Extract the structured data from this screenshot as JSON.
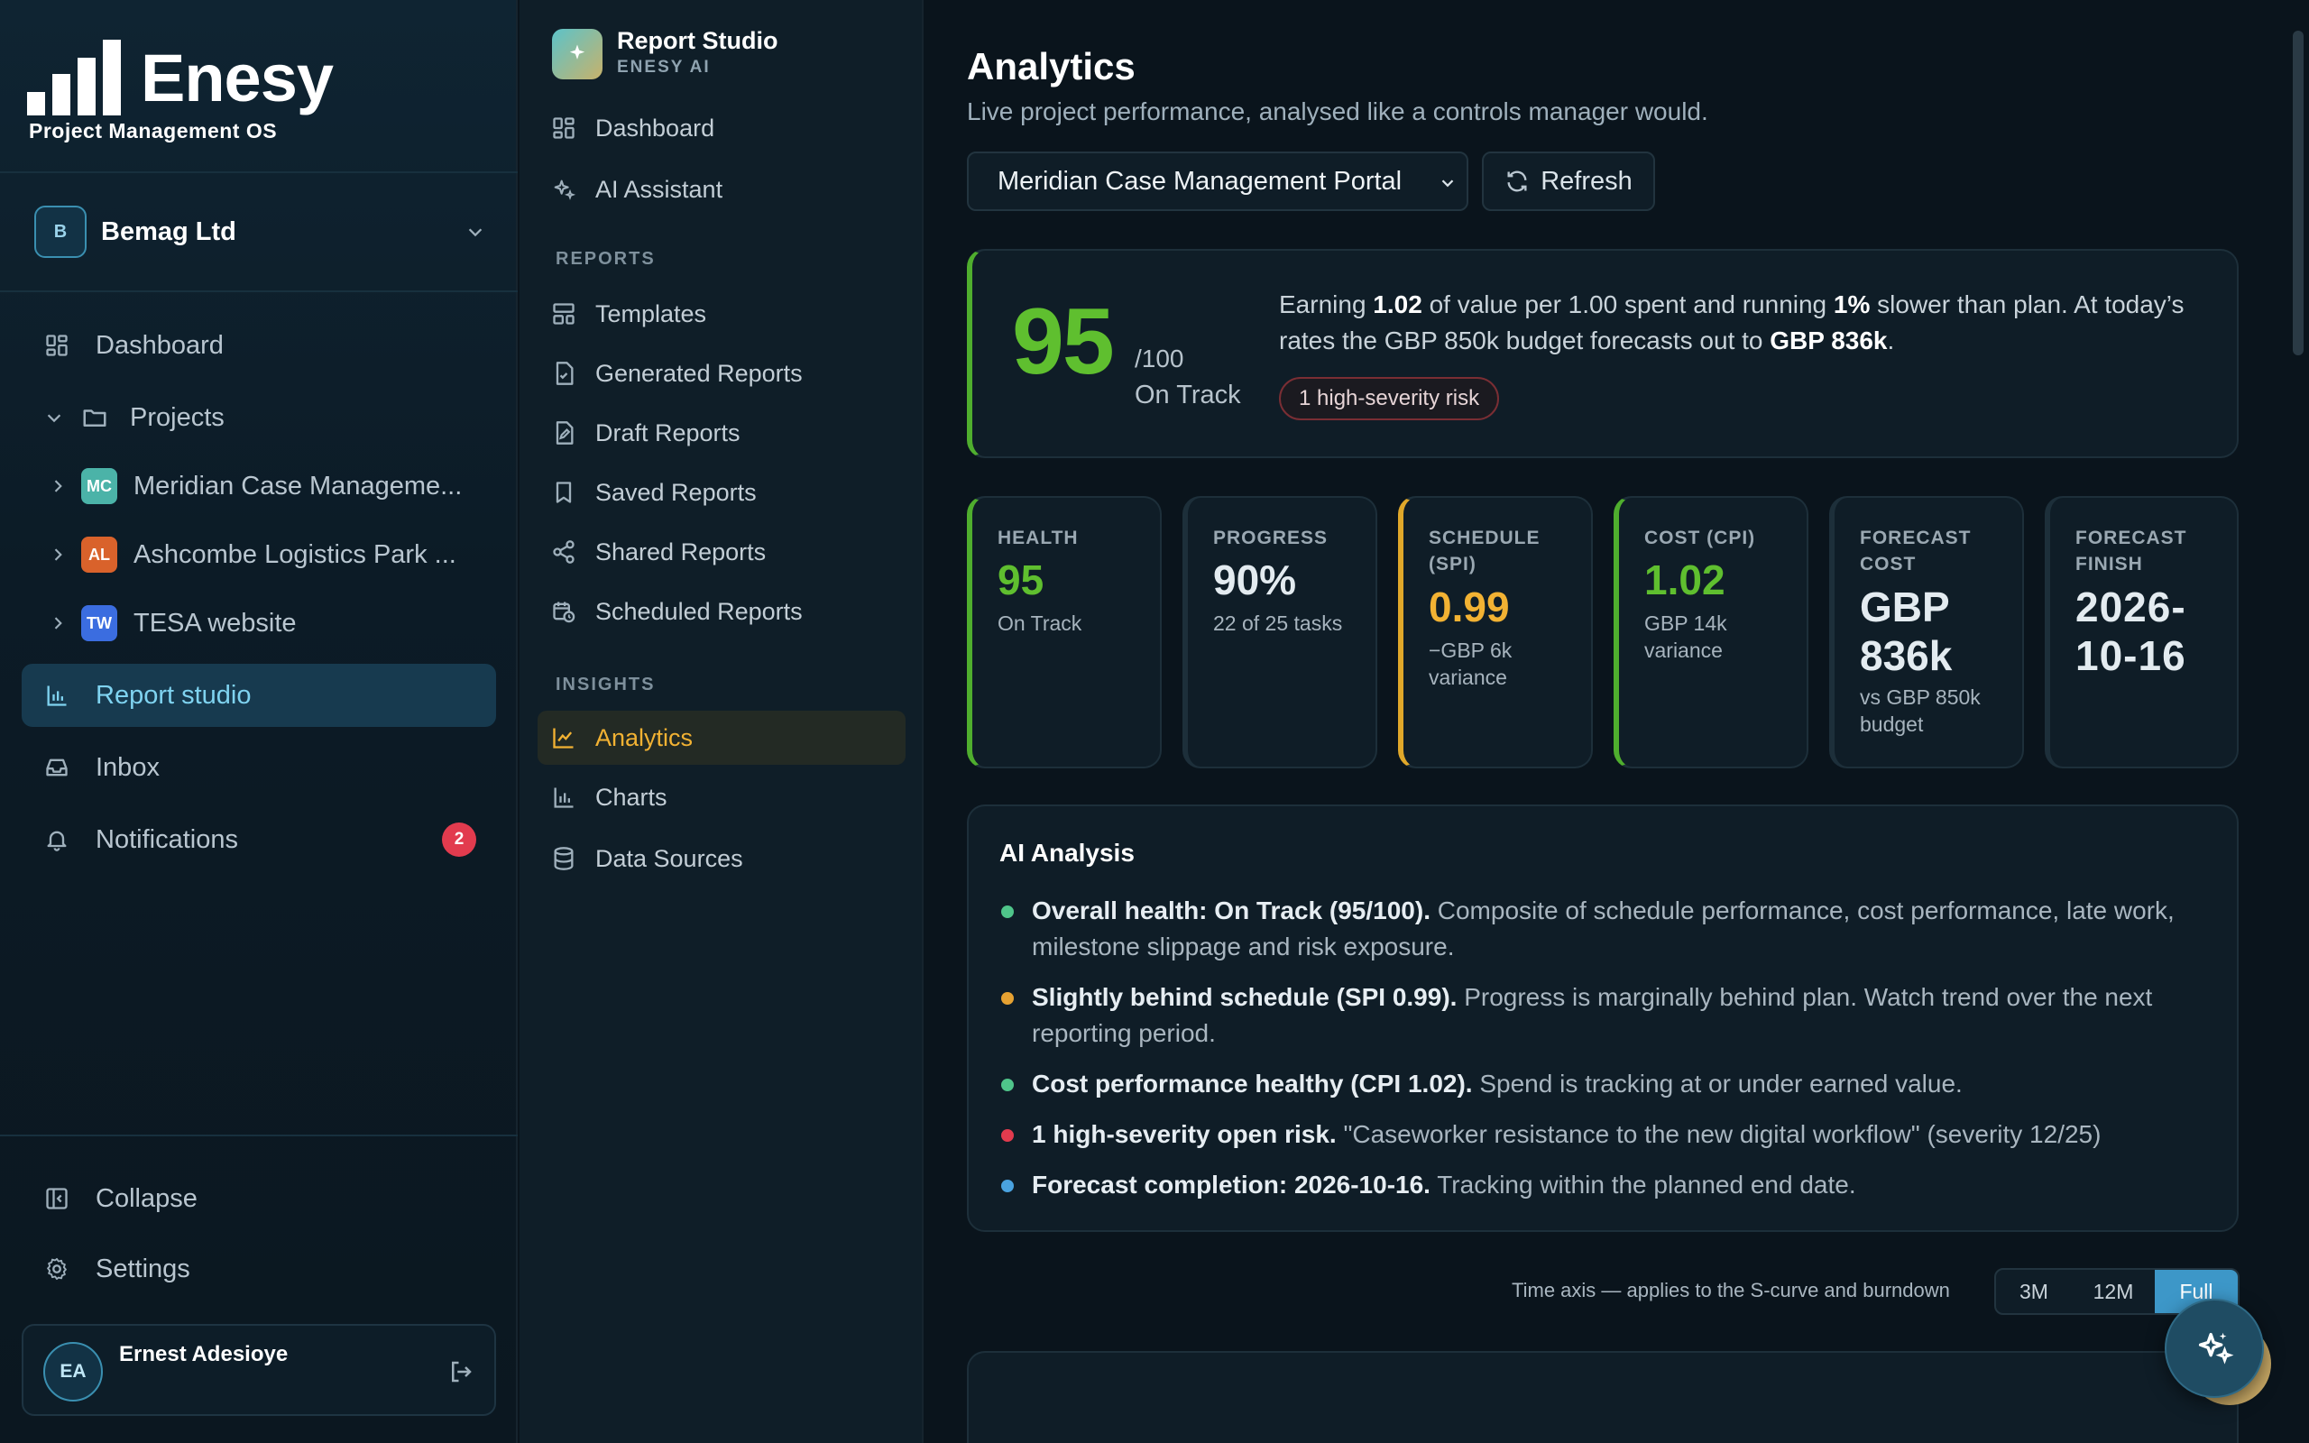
{
  "brand": {
    "name": "Enesy",
    "tagline": "Project Management OS"
  },
  "org": {
    "initial": "B",
    "name": "Bemag Ltd"
  },
  "nav": {
    "dashboard": "Dashboard",
    "projects": "Projects",
    "project_items": [
      {
        "initials": "MC",
        "name": "Meridian Case Manageme...",
        "color": "#4bb3a8"
      },
      {
        "initials": "AL",
        "name": "Ashcombe Logistics Park ...",
        "color": "#d9622b"
      },
      {
        "initials": "TW",
        "name": "TESA website",
        "color": "#3b6de0"
      }
    ],
    "report_studio": "Report studio",
    "inbox": "Inbox",
    "notifications": "Notifications",
    "notifications_count": "2",
    "collapse": "Collapse",
    "settings": "Settings"
  },
  "user": {
    "initials": "EA",
    "name": "Ernest Adesioye"
  },
  "panel": {
    "title": "Report Studio",
    "subtitle": "ENESY AI",
    "dashboard": "Dashboard",
    "ai_assistant": "AI Assistant",
    "reports_heading": "REPORTS",
    "templates": "Templates",
    "generated": "Generated Reports",
    "draft": "Draft Reports",
    "saved": "Saved Reports",
    "shared": "Shared Reports",
    "scheduled": "Scheduled Reports",
    "insights_heading": "INSIGHTS",
    "analytics": "Analytics",
    "charts": "Charts",
    "data_sources": "Data Sources"
  },
  "main": {
    "title": "Analytics",
    "subtitle": "Live project performance, analysed like a controls manager would.",
    "project_select": "Meridian Case Management Portal",
    "refresh": "Refresh"
  },
  "score": {
    "value": "95",
    "max": "/100",
    "status": "On Track",
    "text_1": "Earning ",
    "text_b1": "1.02",
    "text_2": " of value per 1.00 spent and running ",
    "text_b2": "1%",
    "text_3": " slower than plan. At today’s rates the GBP 850k budget forecasts out to ",
    "text_b3": "GBP 836k",
    "text_4": ".",
    "risk_pill": "1 high-severity risk"
  },
  "metrics": [
    {
      "label": "HEALTH",
      "value": "95",
      "sub": "On Track",
      "value_color": "#5fbf2f"
    },
    {
      "label": "PROGRESS",
      "value": "90%",
      "sub": "22 of 25 tasks",
      "value_color": "#e3ebf0"
    },
    {
      "label": "SCHEDULE (SPI)",
      "value": "0.99",
      "sub": "−GBP 6k variance",
      "value_color": "#f2b233"
    },
    {
      "label": "COST (CPI)",
      "value": "1.02",
      "sub": "GBP 14k variance",
      "value_color": "#5fbf2f"
    },
    {
      "label": "FORECAST COST",
      "value": "GBP 836k",
      "sub": "vs GBP 850k budget",
      "value_color": "#e3ebf0"
    },
    {
      "label": "FORECAST FINISH",
      "value": "2026-10-16",
      "sub": "",
      "value_color": "#e3ebf0"
    }
  ],
  "ai": {
    "title": "AI Analysis",
    "items": [
      {
        "bold": "Overall health: On Track (95/100).",
        "text": " Composite of schedule performance, cost performance, late work, milestone slippage and risk exposure.",
        "dot": "#4fc58a"
      },
      {
        "bold": "Slightly behind schedule (SPI 0.99).",
        "text": " Progress is marginally behind plan. Watch trend over the next reporting period.",
        "dot": "#e6a232"
      },
      {
        "bold": "Cost performance healthy (CPI 1.02).",
        "text": " Spend is tracking at or under earned value.",
        "dot": "#4fc58a"
      },
      {
        "bold": "1 high-severity open risk.",
        "text": " \"Caseworker resistance to the new digital workflow\" (severity 12/25)",
        "dot": "#e23b4e"
      },
      {
        "bold": "Forecast completion: 2026-10-16.",
        "text": " Tracking within the planned end date.",
        "dot": "#4aa3e0"
      }
    ]
  },
  "time_axis": {
    "label": "Time axis — applies to the S-curve and burndown",
    "options": [
      "3M",
      "12M",
      "Full"
    ],
    "selected": "Full"
  }
}
